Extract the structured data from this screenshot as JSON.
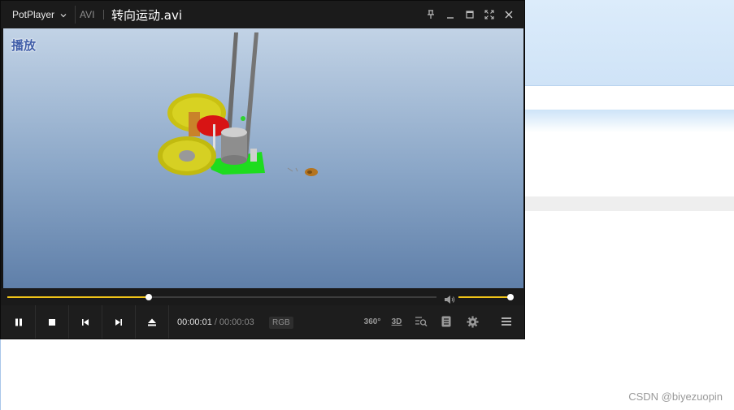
{
  "player": {
    "brand": "PotPlayer",
    "format": "AVI",
    "filename": "转向运动.avi",
    "osd_text": "播放",
    "time_current": "00:00:01",
    "time_separator": "/",
    "time_total": "00:00:03",
    "color_badge": "RGB",
    "seek_progress": 0.33,
    "volume_level": 1.0,
    "accent_color": "#f0c419",
    "buttons": {
      "360": "360°",
      "3d": "3D"
    }
  },
  "icons": [
    "chevron-down-icon",
    "pin-icon",
    "minimize-icon",
    "maximize-icon",
    "fullscreen-icon",
    "close-icon",
    "volume-icon",
    "pause-icon",
    "stop-icon",
    "previous-icon",
    "next-icon",
    "eject-icon",
    "360-icon",
    "3d-icon",
    "playlist-search-icon",
    "chapter-icon",
    "settings-icon",
    "menu-icon"
  ],
  "watermark": "CSDN @biyezuopin"
}
